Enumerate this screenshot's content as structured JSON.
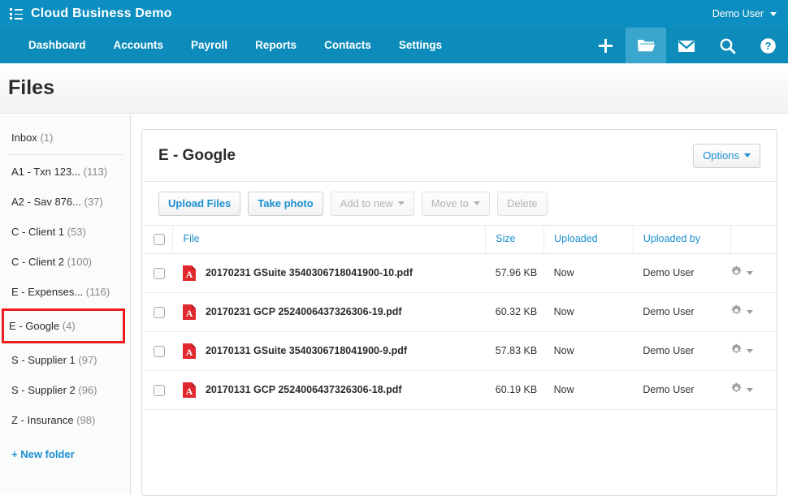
{
  "header": {
    "brand_icon": "list-menu-icon",
    "brand_title": "Cloud Business Demo",
    "user_label": "Demo User",
    "user_caret": "chevron-down-icon"
  },
  "nav": {
    "links": [
      {
        "label": "Dashboard"
      },
      {
        "label": "Accounts"
      },
      {
        "label": "Payroll"
      },
      {
        "label": "Reports"
      },
      {
        "label": "Contacts"
      },
      {
        "label": "Settings"
      }
    ],
    "icons": [
      {
        "name": "plus-icon",
        "glyph": "+",
        "active": false
      },
      {
        "name": "folder-icon",
        "glyph": "folder",
        "active": true
      },
      {
        "name": "envelope-icon",
        "glyph": "mail",
        "active": false
      },
      {
        "name": "search-icon",
        "glyph": "search",
        "active": false
      },
      {
        "name": "help-icon",
        "glyph": "help",
        "active": false
      }
    ]
  },
  "page": {
    "title": "Files"
  },
  "sidebar": {
    "inbox": {
      "label": "Inbox",
      "count": "(1)"
    },
    "folders": [
      {
        "label": "A1 - Txn 123...",
        "count": "(113)",
        "selected": false
      },
      {
        "label": "A2 - Sav 876...",
        "count": "(37)",
        "selected": false
      },
      {
        "label": "C - Client 1",
        "count": "(53)",
        "selected": false
      },
      {
        "label": "C - Client 2",
        "count": "(100)",
        "selected": false
      },
      {
        "label": "E - Expenses...",
        "count": "(116)",
        "selected": false
      },
      {
        "label": "E - Google",
        "count": "(4)",
        "selected": true
      },
      {
        "label": "S - Supplier 1",
        "count": "(97)",
        "selected": false
      },
      {
        "label": "S - Supplier 2",
        "count": "(96)",
        "selected": false
      },
      {
        "label": "Z - Insurance",
        "count": "(98)",
        "selected": false
      }
    ],
    "new_folder_label": "+ New folder",
    "highlight_color": "#ee1c1c"
  },
  "card": {
    "title": "E - Google",
    "options_label": "Options",
    "options_caret": "chevron-down-icon",
    "toolbar": [
      {
        "label": "Upload Files",
        "disabled": false,
        "caret": false
      },
      {
        "label": "Take photo",
        "disabled": false,
        "caret": false
      },
      {
        "label": "Add to new",
        "disabled": true,
        "caret": true
      },
      {
        "label": "Move to",
        "disabled": true,
        "caret": true
      },
      {
        "label": "Delete",
        "disabled": true,
        "caret": false
      }
    ]
  },
  "table": {
    "columns": [
      "File",
      "Size",
      "Uploaded",
      "Uploaded by"
    ],
    "rows": [
      {
        "file": "20170231 GSuite 3540306718041900-10.pdf",
        "size": "57.96 KB",
        "uploaded": "Now",
        "uploaded_by": "Demo User",
        "icon": "pdf-file-icon"
      },
      {
        "file": "20170231 GCP 2524006437326306-19.pdf",
        "size": "60.32 KB",
        "uploaded": "Now",
        "uploaded_by": "Demo User",
        "icon": "pdf-file-icon"
      },
      {
        "file": "20170131 GSuite 3540306718041900-9.pdf",
        "size": "57.83 KB",
        "uploaded": "Now",
        "uploaded_by": "Demo User",
        "icon": "pdf-file-icon"
      },
      {
        "file": "20170131 GCP 2524006437326306-18.pdf",
        "size": "60.19 KB",
        "uploaded": "Now",
        "uploaded_by": "Demo User",
        "icon": "pdf-file-icon"
      }
    ]
  },
  "colors": {
    "brand_top": "#0c8fc0",
    "brand_nav": "#0d8cbb",
    "nav_active": "#3aa6cd",
    "link_blue": "#1a8fd1",
    "pdf_red": "#e0282e",
    "highlight_red": "#ee1c1c"
  }
}
